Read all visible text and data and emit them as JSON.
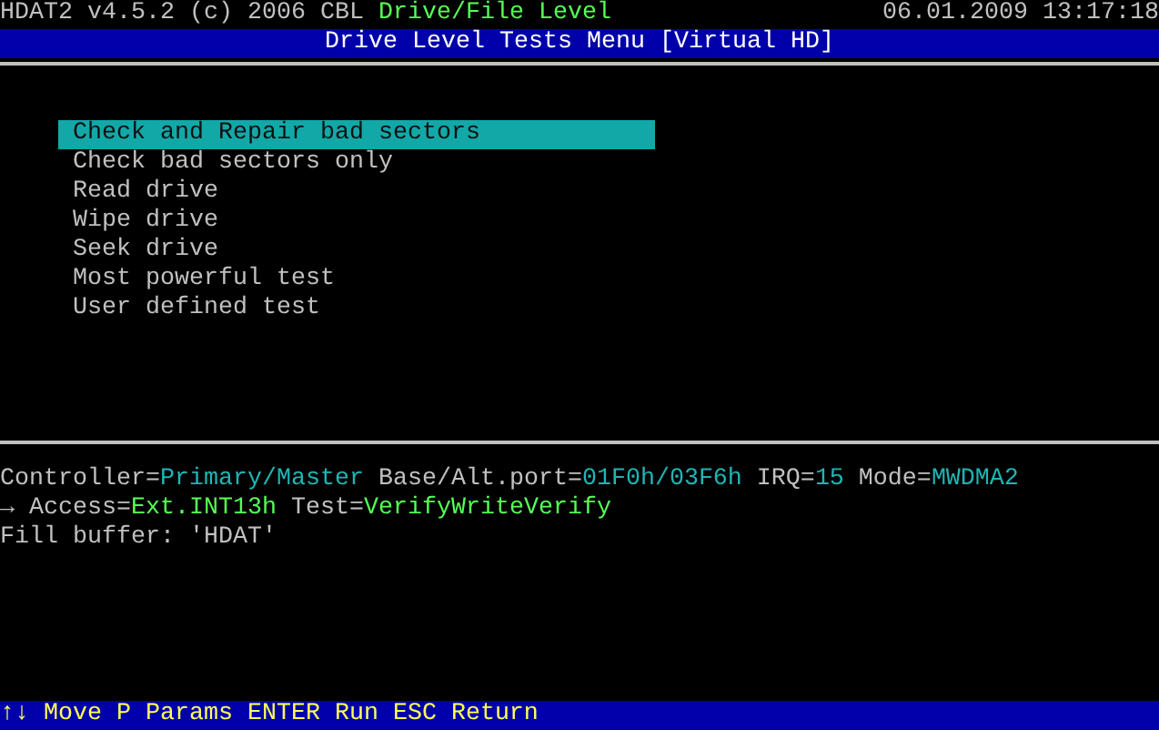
{
  "header": {
    "program": "HDAT2 v4.5.2 (c) 2006 CBL",
    "level": "Drive/File Level",
    "datetime": "06.01.2009 13:17:18"
  },
  "title": "Drive Level Tests Menu [Virtual HD]",
  "menu": [
    {
      "label": "Check and Repair bad sectors",
      "selected": true
    },
    {
      "label": "Check bad sectors only",
      "selected": false
    },
    {
      "label": "Read drive",
      "selected": false
    },
    {
      "label": "Wipe drive",
      "selected": false
    },
    {
      "label": "Seek drive",
      "selected": false
    },
    {
      "label": "Most powerful test",
      "selected": false
    },
    {
      "label": "User defined test",
      "selected": false
    }
  ],
  "info_lines": [
    {
      "segments": [
        {
          "text": "Controller=",
          "color": "#c0c0c0"
        },
        {
          "text": "Primary/Master",
          "color": "#1fb5b5"
        },
        {
          "text": " Base/Alt.port=",
          "color": "#c0c0c0"
        },
        {
          "text": "01F0h/03F6h",
          "color": "#1fb5b5"
        },
        {
          "text": " IRQ=",
          "color": "#c0c0c0"
        },
        {
          "text": "15",
          "color": "#1fb5b5"
        },
        {
          "text": " Mode=",
          "color": "#c0c0c0"
        },
        {
          "text": "MWDMA2",
          "color": "#1fb5b5"
        }
      ]
    },
    {
      "segments": [
        {
          "text": "→ Access=",
          "color": "#c0c0c0"
        },
        {
          "text": "Ext.INT13h",
          "color": "#55ff55"
        },
        {
          "text": " Test=",
          "color": "#c0c0c0"
        },
        {
          "text": "VerifyWriteVerify",
          "color": "#55ff55"
        }
      ]
    },
    {
      "segments": [
        {
          "text": "Fill buffer: 'HDAT'",
          "color": "#c0c0c0"
        }
      ]
    }
  ],
  "footer": "↑↓ Move P Params ENTER Run ESC Return"
}
